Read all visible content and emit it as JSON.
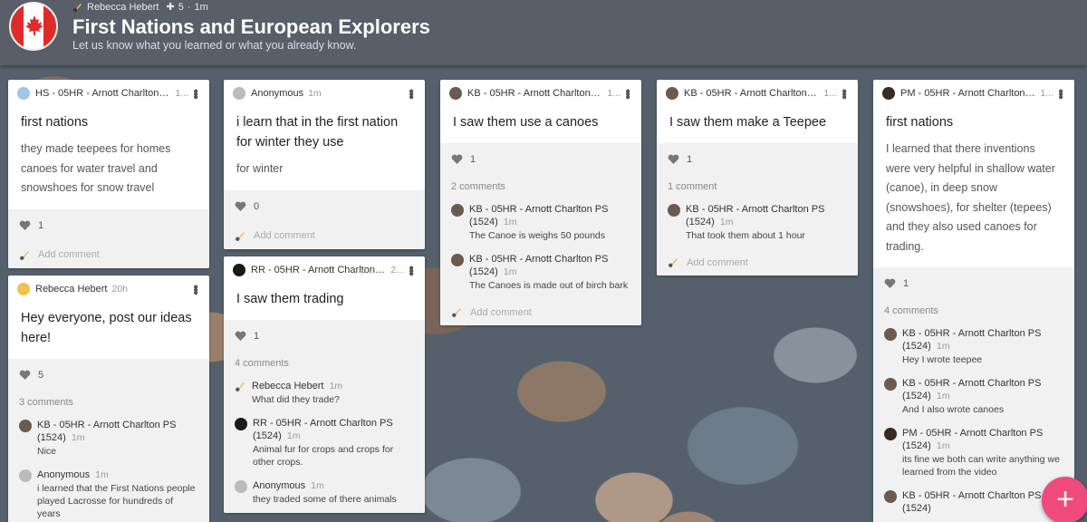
{
  "header": {
    "author": "Rebecca Hebert",
    "likes": "5",
    "time": "1m",
    "title": "First Nations and European Explorers",
    "subtitle": "Let us know what you learned or what you already know."
  },
  "columns": [
    {
      "cards": [
        {
          "author": "HS - 05HR - Arnott Charlton PS (...",
          "time": "1...",
          "title": "first nations",
          "body": "they made teepees for homes canoes for water travel and snowshoes for snow travel",
          "likes": "1",
          "comment_count": "",
          "comments": [],
          "add_comment": "Add comment"
        },
        {
          "author": "Rebecca Hebert",
          "time": "20h",
          "title": "Hey everyone, post our ideas here!",
          "body": "",
          "likes": "5",
          "comment_count": "3 comments",
          "comments": [
            {
              "name": "KB - 05HR - Arnott Charlton PS (1524)",
              "time": "1m",
              "text": "Nice"
            },
            {
              "name": "Anonymous",
              "time": "1m",
              "text": "i learned that the First Nations people played Lacrosse for hundreds of years"
            }
          ],
          "add_comment": ""
        }
      ]
    },
    {
      "cards": [
        {
          "author": "Anonymous",
          "time": "1m",
          "title": "i learn that in the first nation for winter they use",
          "body": "for winter",
          "likes": "0",
          "comment_count": "",
          "comments": [],
          "add_comment": "Add comment"
        },
        {
          "author": "RR - 05HR - Arnott Charlton PS (...",
          "time": "2...",
          "title": "I saw them trading",
          "body": "",
          "likes": "1",
          "comment_count": "4 comments",
          "comments": [
            {
              "name": "Rebecca Hebert",
              "time": "1m",
              "text": "What did they trade?"
            },
            {
              "name": "RR - 05HR - Arnott Charlton PS (1524)",
              "time": "1m",
              "text": "Animal fur for crops and crops for other crops."
            },
            {
              "name": "Anonymous",
              "time": "1m",
              "text": "they traded some of there animals"
            }
          ],
          "add_comment": ""
        }
      ]
    },
    {
      "cards": [
        {
          "author": "KB - 05HR - Arnott Charlton PS (...",
          "time": "1...",
          "title": "I saw them use a canoes",
          "body": "",
          "likes": "1",
          "comment_count": "2 comments",
          "comments": [
            {
              "name": "KB - 05HR - Arnott Charlton PS (1524)",
              "time": "1m",
              "text": "The Canoe is weighs 50 pounds"
            },
            {
              "name": "KB - 05HR - Arnott Charlton PS (1524)",
              "time": "1m",
              "text": "The Canoes is made out of birch bark"
            }
          ],
          "add_comment": "Add comment"
        }
      ]
    },
    {
      "cards": [
        {
          "author": "KB - 05HR - Arnott Charlton PS (...",
          "time": "1...",
          "title": "I saw them make a Teepee",
          "body": "",
          "likes": "1",
          "comment_count": "1 comment",
          "comments": [
            {
              "name": "KB - 05HR - Arnott Charlton PS (1524)",
              "time": "1m",
              "text": "That took them about 1 hour"
            }
          ],
          "add_comment": "Add comment"
        }
      ]
    },
    {
      "cards": [
        {
          "author": "PM - 05HR - Arnott Charlton PS (...",
          "time": "1...",
          "title": "first nations",
          "body": "I learned that there inventions were very helpful in shallow water (canoe), in deep snow (snowshoes), for shelter (tepees) and they also used canoes for trading.",
          "likes": "1",
          "comment_count": "4 comments",
          "comments": [
            {
              "name": "KB - 05HR - Arnott Charlton PS (1524)",
              "time": "1m",
              "text": "Hey I wrote teepee"
            },
            {
              "name": "KB - 05HR - Arnott Charlton PS (1524)",
              "time": "1m",
              "text": "And I also wrote canoes"
            },
            {
              "name": "PM - 05HR - Arnott Charlton PS (1524)",
              "time": "1m",
              "text": "its fine we both can write anything we learned from the video"
            },
            {
              "name": "KB - 05HR - Arnott Charlton PS (1524)",
              "time": "",
              "text": ""
            }
          ],
          "add_comment": ""
        }
      ]
    }
  ],
  "fab_label": "+",
  "colors": {
    "topbar": "#595e69",
    "fab": "#ee4b7c",
    "flag_red": "#e02b2b"
  }
}
